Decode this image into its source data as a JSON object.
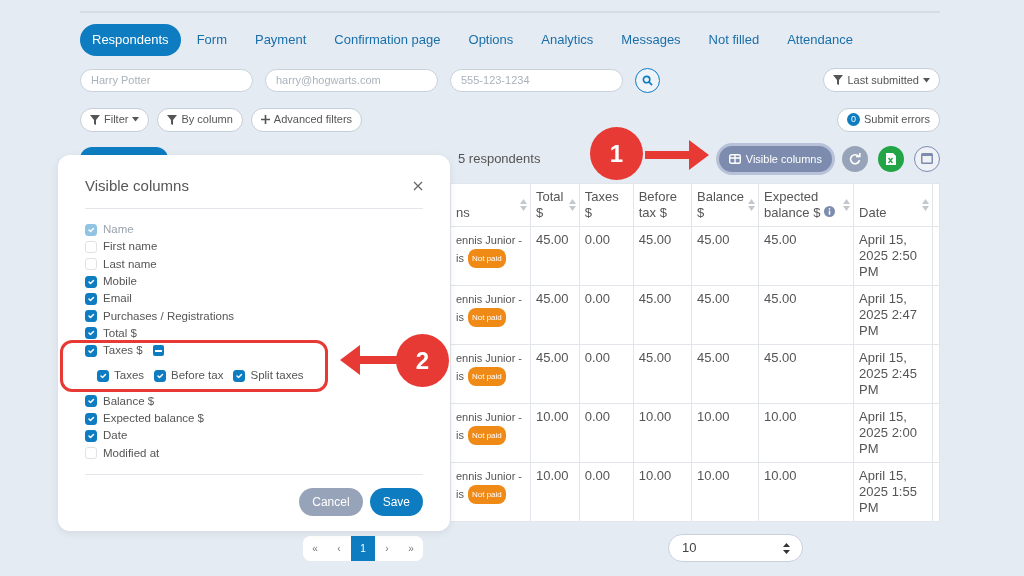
{
  "tabs": [
    {
      "label": "Respondents",
      "selected": true
    },
    {
      "label": "Form",
      "selected": false
    },
    {
      "label": "Payment",
      "selected": false
    },
    {
      "label": "Confirmation page",
      "selected": false
    },
    {
      "label": "Options",
      "selected": false
    },
    {
      "label": "Analytics",
      "selected": false
    },
    {
      "label": "Messages",
      "selected": false
    },
    {
      "label": "Not filled",
      "selected": false
    },
    {
      "label": "Attendance",
      "selected": false
    }
  ],
  "search_fields": [
    {
      "placeholder": "Harry Potter"
    },
    {
      "placeholder": "harry@hogwarts.com"
    },
    {
      "placeholder": "555-123-1234"
    }
  ],
  "sort_dropdown": {
    "label": "Last submitted"
  },
  "filter_buttons": [
    {
      "label": "Filter",
      "kind": "dropdown"
    },
    {
      "label": "By column",
      "kind": "filter"
    },
    {
      "label": "Advanced filters",
      "kind": "add"
    }
  ],
  "submit_errors": {
    "count": "0",
    "label": "Submit errors"
  },
  "respondent_count": "5 respondents",
  "visible_columns_button": {
    "label": "Visible columns",
    "active": true
  },
  "table": {
    "columns": [
      {
        "label": "ns",
        "sortable": true,
        "info": false
      },
      {
        "label": "Total $",
        "sortable": true,
        "info": false
      },
      {
        "label": "Taxes $",
        "sortable": false,
        "info": false
      },
      {
        "label": "Before tax $",
        "sortable": false,
        "info": false
      },
      {
        "label": "Balance $",
        "sortable": true,
        "info": false
      },
      {
        "label": "Expected balance $",
        "sortable": true,
        "info": true
      },
      {
        "label": "Date",
        "sortable": true,
        "info": false
      }
    ],
    "rows": [
      {
        "cells": [
          {
            "lines": [
              "ennis Junior -",
              "is"
            ],
            "status": "Not paid"
          },
          "45.00",
          "0.00",
          "45.00",
          "45.00",
          "45.00",
          "April 15, 2025 2:50 PM"
        ]
      },
      {
        "cells": [
          {
            "lines": [
              "ennis Junior -",
              "is"
            ],
            "status": "Not paid"
          },
          "45.00",
          "0.00",
          "45.00",
          "45.00",
          "45.00",
          "April 15, 2025 2:47 PM"
        ]
      },
      {
        "cells": [
          {
            "lines": [
              "ennis Junior -",
              "is"
            ],
            "status": "Not paid"
          },
          "45.00",
          "0.00",
          "45.00",
          "45.00",
          "45.00",
          "April 15, 2025 2:45 PM"
        ]
      },
      {
        "cells": [
          {
            "lines": [
              "ennis Junior -",
              "is"
            ],
            "status": "Not paid"
          },
          "10.00",
          "0.00",
          "10.00",
          "10.00",
          "10.00",
          "April 15, 2025 2:00 PM"
        ]
      },
      {
        "cells": [
          {
            "lines": [
              "ennis Junior -",
              "is"
            ],
            "status": "Not paid"
          },
          "10.00",
          "0.00",
          "10.00",
          "10.00",
          "10.00",
          "April 15, 2025 1:55 PM"
        ]
      }
    ]
  },
  "pagination": [
    {
      "label": "«",
      "selected": false
    },
    {
      "label": "‹",
      "selected": false
    },
    {
      "label": "1",
      "selected": true
    },
    {
      "label": "›",
      "selected": false
    },
    {
      "label": "»",
      "selected": false
    }
  ],
  "page_size": "10",
  "modal": {
    "title": "Visible columns",
    "columns": [
      {
        "label": "Name",
        "checked": true,
        "disabled": true
      },
      {
        "label": "First name",
        "checked": false,
        "disabled": false
      },
      {
        "label": "Last name",
        "checked": false,
        "disabled": false
      },
      {
        "label": "Mobile",
        "checked": true,
        "disabled": false
      },
      {
        "label": "Email",
        "checked": true,
        "disabled": false
      },
      {
        "label": "Purchases / Registrations",
        "checked": true,
        "disabled": false
      },
      {
        "label": "Total $",
        "checked": true,
        "disabled": false
      },
      {
        "label": "Taxes $",
        "checked": true,
        "disabled": false,
        "expanded": true,
        "children": [
          {
            "label": "Taxes",
            "checked": true
          },
          {
            "label": "Before tax",
            "checked": true
          },
          {
            "label": "Split taxes",
            "checked": true
          }
        ]
      },
      {
        "label": "Balance $",
        "checked": true,
        "disabled": false
      },
      {
        "label": "Expected balance $",
        "checked": true,
        "disabled": false
      },
      {
        "label": "Date",
        "checked": true,
        "disabled": false
      },
      {
        "label": "Modified at",
        "checked": false,
        "disabled": false
      }
    ],
    "buttons": [
      {
        "label": "Cancel",
        "kind": "secondary"
      },
      {
        "label": "Save",
        "kind": "primary"
      }
    ]
  },
  "annotations": [
    {
      "number": "1"
    },
    {
      "number": "2"
    }
  ]
}
